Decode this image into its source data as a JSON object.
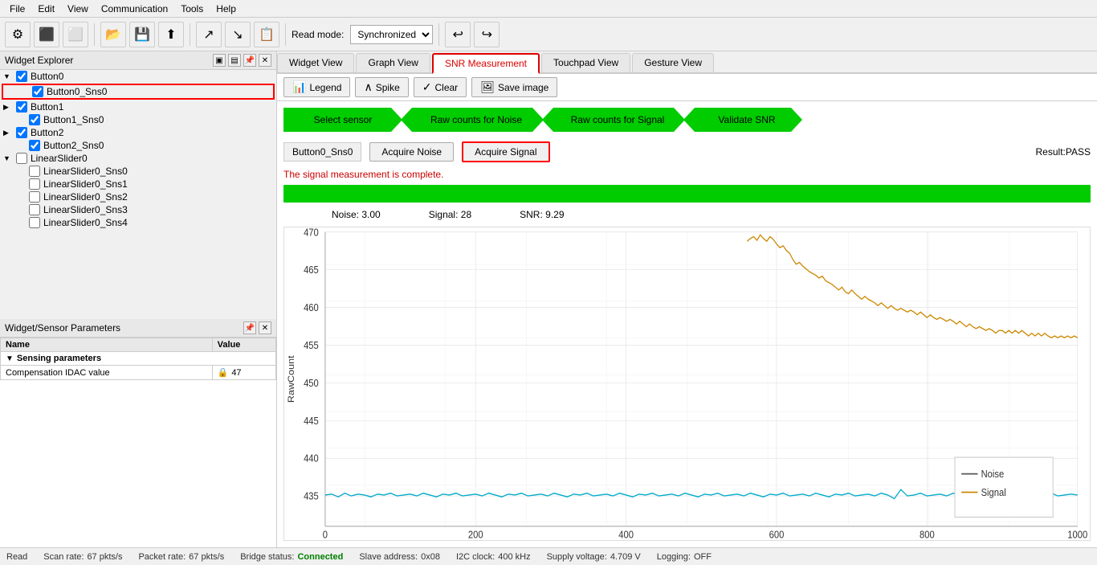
{
  "menu": {
    "items": [
      "File",
      "Edit",
      "View",
      "Communication",
      "Tools",
      "Help"
    ]
  },
  "toolbar": {
    "read_mode_label": "Read mode:",
    "read_mode_value": "Synchronized"
  },
  "left_panel": {
    "widget_explorer_title": "Widget Explorer",
    "widget_sensor_title": "Widget/Sensor Parameters",
    "tree_items": [
      {
        "id": "btn0",
        "label": "Button0",
        "level": 0,
        "checked": true,
        "expanded": true,
        "is_group": true
      },
      {
        "id": "btn0_sns0",
        "label": "Button0_Sns0",
        "level": 1,
        "checked": true,
        "selected": true
      },
      {
        "id": "btn1",
        "label": "Button1",
        "level": 0,
        "checked": true,
        "expanded": false,
        "is_group": true
      },
      {
        "id": "btn1_sns0",
        "label": "Button1_Sns0",
        "level": 1,
        "checked": true
      },
      {
        "id": "btn2",
        "label": "Button2",
        "level": 0,
        "checked": true,
        "expanded": false,
        "is_group": true
      },
      {
        "id": "btn2_sns0",
        "label": "Button2_Sns0",
        "level": 1,
        "checked": true
      },
      {
        "id": "ls0",
        "label": "LinearSlider0",
        "level": 0,
        "checked": false,
        "expanded": true,
        "is_group": true
      },
      {
        "id": "ls0_sns0",
        "label": "LinearSlider0_Sns0",
        "level": 1,
        "checked": false
      },
      {
        "id": "ls0_sns1",
        "label": "LinearSlider0_Sns1",
        "level": 1,
        "checked": false
      },
      {
        "id": "ls0_sns2",
        "label": "LinearSlider0_Sns2",
        "level": 1,
        "checked": false
      },
      {
        "id": "ls0_sns3",
        "label": "LinearSlider0_Sns3",
        "level": 1,
        "checked": false
      },
      {
        "id": "ls0_sns4",
        "label": "LinearSlider0_Sns4",
        "level": 1,
        "checked": false
      }
    ],
    "params": {
      "name_col": "Name",
      "value_col": "Value",
      "section": "Sensing parameters",
      "rows": [
        {
          "name": "Compensation IDAC value",
          "value": "47"
        }
      ]
    }
  },
  "tabs": {
    "items": [
      "Widget View",
      "Graph View",
      "SNR Measurement",
      "Touchpad View",
      "Gesture View"
    ],
    "active": "SNR Measurement"
  },
  "snr": {
    "toolbar": {
      "legend_label": "Legend",
      "spike_label": "Spike",
      "clear_label": "Clear",
      "save_image_label": "Save image"
    },
    "steps": [
      {
        "label": "Select sensor",
        "active": true
      },
      {
        "label": "Raw counts for Noise",
        "active": true
      },
      {
        "label": "Raw counts for Signal",
        "active": true
      },
      {
        "label": "Validate SNR",
        "active": true
      }
    ],
    "sensor_label": "Button0_Sns0",
    "acquire_noise_label": "Acquire Noise",
    "acquire_signal_label": "Acquire Signal",
    "result_label": "Result:PASS",
    "status_message": "The signal measurement is complete.",
    "noise_label": "Noise:",
    "noise_value": "3.00",
    "signal_label": "Signal:",
    "signal_value": "28",
    "snr_label": "SNR:",
    "snr_value": "9.29",
    "chart": {
      "y_axis_label": "RawCount",
      "y_min": 435,
      "y_max": 470,
      "y_ticks": [
        435,
        440,
        445,
        450,
        455,
        460,
        465,
        470
      ],
      "x_min": 0,
      "x_max": 1000,
      "x_ticks": [
        0,
        200,
        400,
        600,
        800,
        1000
      ],
      "legend": [
        {
          "label": "Noise",
          "color": "#555555"
        },
        {
          "label": "Signal",
          "color": "#cc8800"
        }
      ]
    }
  },
  "status_bar": {
    "read_label": "Read",
    "scan_rate_label": "Scan rate:",
    "scan_rate_value": "67 pkts/s",
    "packet_rate_label": "Packet rate:",
    "packet_rate_value": "67 pkts/s",
    "bridge_status_label": "Bridge status:",
    "bridge_status_value": "Connected",
    "slave_addr_label": "Slave address:",
    "slave_addr_value": "0x08",
    "i2c_clock_label": "I2C clock:",
    "i2c_clock_value": "400 kHz",
    "supply_voltage_label": "Supply voltage:",
    "supply_voltage_value": "4.709 V",
    "logging_label": "Logging:",
    "logging_value": "OFF"
  }
}
